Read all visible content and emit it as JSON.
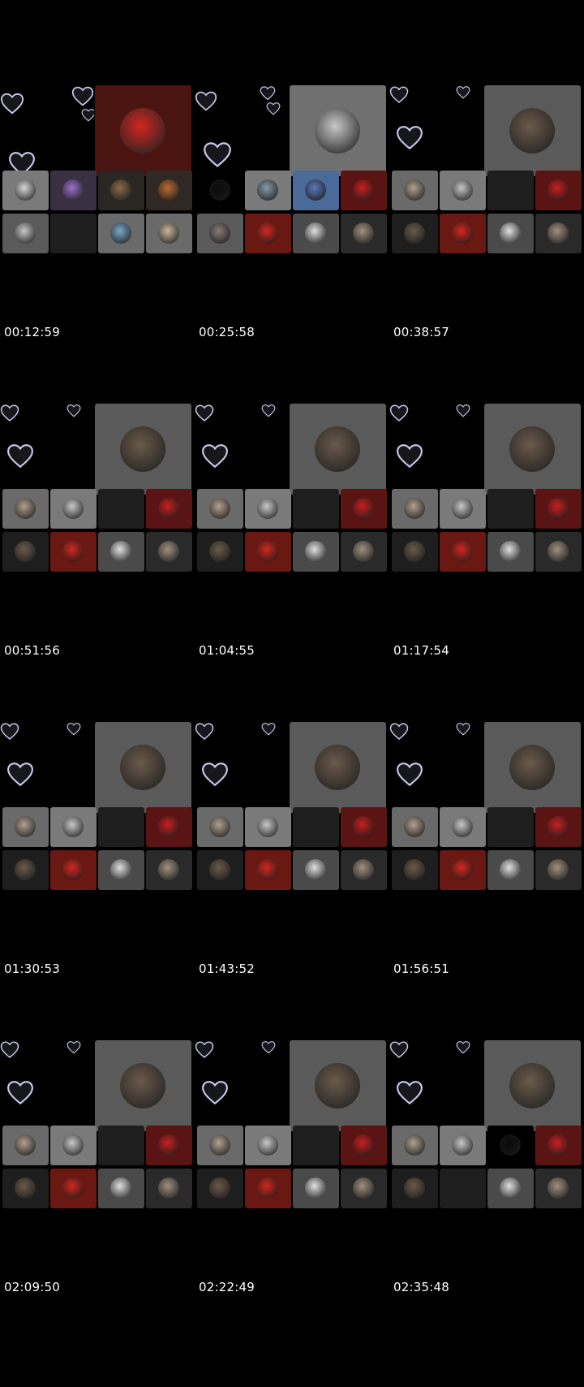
{
  "frames": [
    {
      "timestamp": "00:12:59",
      "main": {
        "tile_bg": "#4a1410",
        "avatar": "red-face",
        "avatar_color": "#d3261e"
      },
      "row1": [
        {
          "tile_bg": "#7a7a7a",
          "avatar": "skull",
          "avatar_color": "#d8d8d8"
        },
        {
          "tile_bg": "#3a3044",
          "avatar": "anime-girl",
          "avatar_color": "#9a70c8"
        },
        {
          "tile_bg": "#2a2622",
          "avatar": "coffee",
          "avatar_color": "#8a6a48"
        },
        {
          "tile_bg": "#302824",
          "avatar": "person-orange",
          "avatar_color": "#b86a36"
        }
      ],
      "row2": [
        {
          "tile_bg": "#5a5a5a",
          "avatar": "person-dark",
          "avatar_color": "#c8c8c8"
        },
        {
          "tile_bg": "#1e1e1e",
          "avatar": "none",
          "avatar_color": "#1e1e1e"
        },
        {
          "tile_bg": "#6a6a6a",
          "avatar": "beach",
          "avatar_color": "#7aa8c8"
        },
        {
          "tile_bg": "#6a6a6a",
          "avatar": "beach-sand",
          "avatar_color": "#c8b89a"
        }
      ]
    },
    {
      "timestamp": "00:25:58",
      "main": {
        "tile_bg": "#707070",
        "avatar": "man-white-suit",
        "avatar_color": "#c8c8c8"
      },
      "row1": [
        {
          "tile_bg": "#000000",
          "avatar": "dark",
          "avatar_color": "#0a0a0a"
        },
        {
          "tile_bg": "#7a7a7a",
          "avatar": "street",
          "avatar_color": "#8a9aa8"
        },
        {
          "tile_bg": "#4a6a9a",
          "avatar": "blue-creature",
          "avatar_color": "#5a7ab8"
        },
        {
          "tile_bg": "#5a1414",
          "avatar": "morocco-flag",
          "avatar_color": "#c81e1e"
        }
      ],
      "row2": [
        {
          "tile_bg": "#5a5a5a",
          "avatar": "woman",
          "avatar_color": "#8a7a7a"
        },
        {
          "tile_bg": "#6a1812",
          "avatar": "red-face",
          "avatar_color": "#d3261e"
        },
        {
          "tile_bg": "#4a4a4a",
          "avatar": "mask",
          "avatar_color": "#e0e0e0"
        },
        {
          "tile_bg": "#2a2a2a",
          "avatar": "flowers",
          "avatar_color": "#a09080"
        }
      ]
    },
    {
      "timestamp": "00:38:57",
      "main": {
        "tile_bg": "#5a5a5a",
        "avatar": "woman-hair",
        "avatar_color": "#6a5a4a"
      },
      "row1": [
        {
          "tile_bg": "#6a6a6a",
          "avatar": "colorful",
          "avatar_color": "#b0a090"
        },
        {
          "tile_bg": "#7a7a7a",
          "avatar": "man-white-suit",
          "avatar_color": "#c8c8c8"
        },
        {
          "tile_bg": "#1e1e1e",
          "avatar": "none",
          "avatar_color": "#1e1e1e"
        },
        {
          "tile_bg": "#5a1414",
          "avatar": "morocco-flag",
          "avatar_color": "#c81e1e"
        }
      ],
      "row2": [
        {
          "tile_bg": "#1e1e1e",
          "avatar": "pickaxe",
          "avatar_color": "#6a5a4a"
        },
        {
          "tile_bg": "#6a1812",
          "avatar": "red-face",
          "avatar_color": "#d3261e"
        },
        {
          "tile_bg": "#4a4a4a",
          "avatar": "mask",
          "avatar_color": "#e0e0e0"
        },
        {
          "tile_bg": "#2a2a2a",
          "avatar": "flowers",
          "avatar_color": "#a09080"
        }
      ]
    },
    {
      "timestamp": "00:51:56",
      "main": {
        "tile_bg": "#5a5a5a",
        "avatar": "woman-hair",
        "avatar_color": "#6a5a4a"
      },
      "row1": [
        {
          "tile_bg": "#6a6a6a",
          "avatar": "colorful",
          "avatar_color": "#b0a090"
        },
        {
          "tile_bg": "#7a7a7a",
          "avatar": "man-white-suit",
          "avatar_color": "#c8c8c8"
        },
        {
          "tile_bg": "#1e1e1e",
          "avatar": "none",
          "avatar_color": "#1e1e1e"
        },
        {
          "tile_bg": "#5a1414",
          "avatar": "morocco-flag",
          "avatar_color": "#c81e1e"
        }
      ],
      "row2": [
        {
          "tile_bg": "#1e1e1e",
          "avatar": "pickaxe",
          "avatar_color": "#6a5a4a"
        },
        {
          "tile_bg": "#6a1812",
          "avatar": "red-face",
          "avatar_color": "#d3261e"
        },
        {
          "tile_bg": "#4a4a4a",
          "avatar": "mask",
          "avatar_color": "#e0e0e0"
        },
        {
          "tile_bg": "#2a2a2a",
          "avatar": "flowers",
          "avatar_color": "#a09080"
        }
      ]
    },
    {
      "timestamp": "01:04:55",
      "main": {
        "tile_bg": "#5a5a5a",
        "avatar": "woman-hair",
        "avatar_color": "#6a5a4a"
      },
      "row1": [
        {
          "tile_bg": "#6a6a6a",
          "avatar": "colorful",
          "avatar_color": "#b0a090"
        },
        {
          "tile_bg": "#7a7a7a",
          "avatar": "man-white-suit",
          "avatar_color": "#c8c8c8"
        },
        {
          "tile_bg": "#1e1e1e",
          "avatar": "none",
          "avatar_color": "#1e1e1e"
        },
        {
          "tile_bg": "#5a1414",
          "avatar": "morocco-flag",
          "avatar_color": "#c81e1e"
        }
      ],
      "row2": [
        {
          "tile_bg": "#1e1e1e",
          "avatar": "pickaxe",
          "avatar_color": "#6a5a4a"
        },
        {
          "tile_bg": "#6a1812",
          "avatar": "red-face",
          "avatar_color": "#d3261e"
        },
        {
          "tile_bg": "#4a4a4a",
          "avatar": "mask",
          "avatar_color": "#e0e0e0"
        },
        {
          "tile_bg": "#2a2a2a",
          "avatar": "flowers",
          "avatar_color": "#a09080"
        }
      ]
    },
    {
      "timestamp": "01:17:54",
      "main": {
        "tile_bg": "#5a5a5a",
        "avatar": "woman-hair",
        "avatar_color": "#6a5a4a"
      },
      "row1": [
        {
          "tile_bg": "#6a6a6a",
          "avatar": "colorful",
          "avatar_color": "#b0a090"
        },
        {
          "tile_bg": "#7a7a7a",
          "avatar": "man-white-suit",
          "avatar_color": "#c8c8c8"
        },
        {
          "tile_bg": "#1e1e1e",
          "avatar": "none",
          "avatar_color": "#1e1e1e"
        },
        {
          "tile_bg": "#5a1414",
          "avatar": "morocco-flag",
          "avatar_color": "#c81e1e"
        }
      ],
      "row2": [
        {
          "tile_bg": "#1e1e1e",
          "avatar": "pickaxe",
          "avatar_color": "#6a5a4a"
        },
        {
          "tile_bg": "#6a1812",
          "avatar": "red-face",
          "avatar_color": "#d3261e"
        },
        {
          "tile_bg": "#4a4a4a",
          "avatar": "mask",
          "avatar_color": "#e0e0e0"
        },
        {
          "tile_bg": "#2a2a2a",
          "avatar": "flowers",
          "avatar_color": "#a09080"
        }
      ]
    },
    {
      "timestamp": "01:30:53",
      "main": {
        "tile_bg": "#5a5a5a",
        "avatar": "woman-hair",
        "avatar_color": "#6a5a4a"
      },
      "row1": [
        {
          "tile_bg": "#6a6a6a",
          "avatar": "colorful",
          "avatar_color": "#b0a090"
        },
        {
          "tile_bg": "#7a7a7a",
          "avatar": "man-white-suit",
          "avatar_color": "#c8c8c8"
        },
        {
          "tile_bg": "#1e1e1e",
          "avatar": "none",
          "avatar_color": "#1e1e1e"
        },
        {
          "tile_bg": "#5a1414",
          "avatar": "morocco-flag",
          "avatar_color": "#c81e1e"
        }
      ],
      "row2": [
        {
          "tile_bg": "#1e1e1e",
          "avatar": "pickaxe",
          "avatar_color": "#6a5a4a"
        },
        {
          "tile_bg": "#6a1812",
          "avatar": "red-face",
          "avatar_color": "#d3261e"
        },
        {
          "tile_bg": "#4a4a4a",
          "avatar": "mask",
          "avatar_color": "#e0e0e0"
        },
        {
          "tile_bg": "#2a2a2a",
          "avatar": "flowers",
          "avatar_color": "#a09080"
        }
      ]
    },
    {
      "timestamp": "01:43:52",
      "main": {
        "tile_bg": "#5a5a5a",
        "avatar": "woman-hair",
        "avatar_color": "#6a5a4a"
      },
      "row1": [
        {
          "tile_bg": "#6a6a6a",
          "avatar": "colorful",
          "avatar_color": "#b0a090"
        },
        {
          "tile_bg": "#7a7a7a",
          "avatar": "man-white-suit",
          "avatar_color": "#c8c8c8"
        },
        {
          "tile_bg": "#1e1e1e",
          "avatar": "none",
          "avatar_color": "#1e1e1e"
        },
        {
          "tile_bg": "#5a1414",
          "avatar": "morocco-flag",
          "avatar_color": "#c81e1e"
        }
      ],
      "row2": [
        {
          "tile_bg": "#1e1e1e",
          "avatar": "pickaxe",
          "avatar_color": "#6a5a4a"
        },
        {
          "tile_bg": "#6a1812",
          "avatar": "red-face",
          "avatar_color": "#d3261e"
        },
        {
          "tile_bg": "#4a4a4a",
          "avatar": "mask",
          "avatar_color": "#e0e0e0"
        },
        {
          "tile_bg": "#2a2a2a",
          "avatar": "flowers",
          "avatar_color": "#a09080"
        }
      ]
    },
    {
      "timestamp": "01:56:51",
      "main": {
        "tile_bg": "#5a5a5a",
        "avatar": "woman-hair",
        "avatar_color": "#6a5a4a"
      },
      "row1": [
        {
          "tile_bg": "#6a6a6a",
          "avatar": "colorful",
          "avatar_color": "#b0a090"
        },
        {
          "tile_bg": "#7a7a7a",
          "avatar": "man-white-suit",
          "avatar_color": "#c8c8c8"
        },
        {
          "tile_bg": "#1e1e1e",
          "avatar": "none",
          "avatar_color": "#1e1e1e"
        },
        {
          "tile_bg": "#5a1414",
          "avatar": "morocco-flag",
          "avatar_color": "#c81e1e"
        }
      ],
      "row2": [
        {
          "tile_bg": "#1e1e1e",
          "avatar": "pickaxe",
          "avatar_color": "#6a5a4a"
        },
        {
          "tile_bg": "#6a1812",
          "avatar": "red-face",
          "avatar_color": "#d3261e"
        },
        {
          "tile_bg": "#4a4a4a",
          "avatar": "mask",
          "avatar_color": "#e0e0e0"
        },
        {
          "tile_bg": "#2a2a2a",
          "avatar": "flowers",
          "avatar_color": "#a09080"
        }
      ]
    },
    {
      "timestamp": "02:09:50",
      "main": {
        "tile_bg": "#5a5a5a",
        "avatar": "woman-hair",
        "avatar_color": "#6a5a4a"
      },
      "row1": [
        {
          "tile_bg": "#6a6a6a",
          "avatar": "colorful",
          "avatar_color": "#b0a090"
        },
        {
          "tile_bg": "#7a7a7a",
          "avatar": "man-white-suit",
          "avatar_color": "#c8c8c8"
        },
        {
          "tile_bg": "#1e1e1e",
          "avatar": "none",
          "avatar_color": "#1e1e1e"
        },
        {
          "tile_bg": "#5a1414",
          "avatar": "morocco-flag",
          "avatar_color": "#c81e1e"
        }
      ],
      "row2": [
        {
          "tile_bg": "#1e1e1e",
          "avatar": "pickaxe",
          "avatar_color": "#6a5a4a"
        },
        {
          "tile_bg": "#6a1812",
          "avatar": "red-face",
          "avatar_color": "#d3261e"
        },
        {
          "tile_bg": "#4a4a4a",
          "avatar": "mask",
          "avatar_color": "#e0e0e0"
        },
        {
          "tile_bg": "#2a2a2a",
          "avatar": "flowers",
          "avatar_color": "#a09080"
        }
      ]
    },
    {
      "timestamp": "02:22:49",
      "main": {
        "tile_bg": "#5a5a5a",
        "avatar": "woman-hair",
        "avatar_color": "#6a5a4a"
      },
      "row1": [
        {
          "tile_bg": "#6a6a6a",
          "avatar": "colorful",
          "avatar_color": "#b0a090"
        },
        {
          "tile_bg": "#7a7a7a",
          "avatar": "man-white-suit",
          "avatar_color": "#c8c8c8"
        },
        {
          "tile_bg": "#1e1e1e",
          "avatar": "none",
          "avatar_color": "#1e1e1e"
        },
        {
          "tile_bg": "#5a1414",
          "avatar": "morocco-flag",
          "avatar_color": "#c81e1e"
        }
      ],
      "row2": [
        {
          "tile_bg": "#1e1e1e",
          "avatar": "pickaxe",
          "avatar_color": "#6a5a4a"
        },
        {
          "tile_bg": "#6a1812",
          "avatar": "red-face",
          "avatar_color": "#d3261e"
        },
        {
          "tile_bg": "#4a4a4a",
          "avatar": "mask",
          "avatar_color": "#e0e0e0"
        },
        {
          "tile_bg": "#2a2a2a",
          "avatar": "flowers",
          "avatar_color": "#a09080"
        }
      ]
    },
    {
      "timestamp": "02:35:48",
      "main": {
        "tile_bg": "#5a5a5a",
        "avatar": "woman-hair",
        "avatar_color": "#6a5a4a"
      },
      "row1": [
        {
          "tile_bg": "#6a6a6a",
          "avatar": "colorful",
          "avatar_color": "#b0a090"
        },
        {
          "tile_bg": "#7a7a7a",
          "avatar": "man-white-suit",
          "avatar_color": "#c8c8c8"
        },
        {
          "tile_bg": "#000000",
          "avatar": "dark",
          "avatar_color": "#0a0a0a"
        },
        {
          "tile_bg": "#5a1414",
          "avatar": "morocco-flag",
          "avatar_color": "#c81e1e"
        }
      ],
      "row2": [
        {
          "tile_bg": "#1e1e1e",
          "avatar": "pickaxe",
          "avatar_color": "#6a5a4a"
        },
        {
          "tile_bg": "#1e1e1e",
          "avatar": "none",
          "avatar_color": "#1e1e1e"
        },
        {
          "tile_bg": "#4a4a4a",
          "avatar": "mask",
          "avatar_color": "#e0e0e0"
        },
        {
          "tile_bg": "#2a2a2a",
          "avatar": "flowers",
          "avatar_color": "#a09080"
        }
      ]
    }
  ],
  "colors": {
    "background": "#000000",
    "text": "#ffffff",
    "heart_outline": "#c8c8e8"
  }
}
